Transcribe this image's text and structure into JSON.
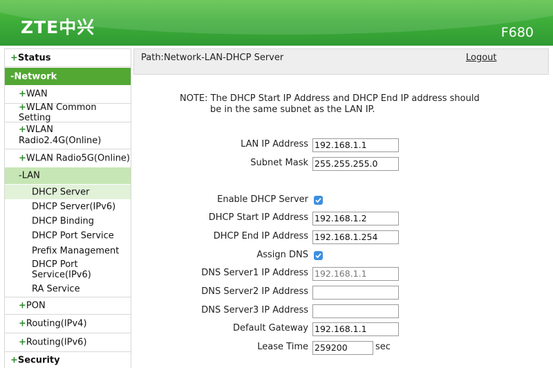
{
  "header": {
    "logo": "ZTE中兴",
    "model": "F680"
  },
  "sidebar": {
    "status": "Status",
    "network": "-Network",
    "wan": "WAN",
    "wlan_common": "WLAN Common Setting",
    "wlan_24_line1": "WLAN",
    "wlan_24_line2": "Radio2.4G(Online)",
    "wlan_5g": "WLAN Radio5G(Online)",
    "lan": "-LAN",
    "lan_items": {
      "dhcp_server": "DHCP Server",
      "dhcp_server_ipv6": "DHCP Server(IPv6)",
      "dhcp_binding": "DHCP Binding",
      "dhcp_port_service": "DHCP Port Service",
      "prefix_management": "Prefix Management",
      "dhcp_port_ipv6_line1": "DHCP Port",
      "dhcp_port_ipv6_line2": "Service(IPv6)",
      "ra_service": "RA Service"
    },
    "pon": "PON",
    "routing_ipv4": "Routing(IPv4)",
    "routing_ipv6": "Routing(IPv6)",
    "security": "Security"
  },
  "pathbar": {
    "path": "Path:Network-LAN-DHCP Server",
    "logout": "Logout"
  },
  "note": {
    "line1": "NOTE: The DHCP Start IP Address and DHCP End IP address should",
    "line2": "be in the same subnet as the LAN IP."
  },
  "form": {
    "lan_ip": {
      "label": "LAN IP Address",
      "value": "192.168.1.1"
    },
    "subnet": {
      "label": "Subnet Mask",
      "value": "255.255.255.0"
    },
    "enable_dhcp": {
      "label": "Enable DHCP Server",
      "checked": true
    },
    "start_ip": {
      "label": "DHCP Start IP Address",
      "value": "192.168.1.2"
    },
    "end_ip": {
      "label": "DHCP End IP Address",
      "value": "192.168.1.254"
    },
    "assign_dns": {
      "label": "Assign DNS",
      "checked": true
    },
    "dns1": {
      "label": "DNS Server1 IP Address",
      "value": "192.168.1.1"
    },
    "dns2": {
      "label": "DNS Server2 IP Address",
      "value": ""
    },
    "dns3": {
      "label": "DNS Server3 IP Address",
      "value": ""
    },
    "gateway": {
      "label": "Default Gateway",
      "value": "192.168.1.1"
    },
    "lease": {
      "label": "Lease Time",
      "value": "259200",
      "unit": "sec"
    }
  },
  "colors": {
    "header_green": "#3fae3a",
    "nav_active": "#52a833",
    "lan_highlight": "#c7e6b5",
    "checkbox_blue": "#3d8fe0"
  }
}
